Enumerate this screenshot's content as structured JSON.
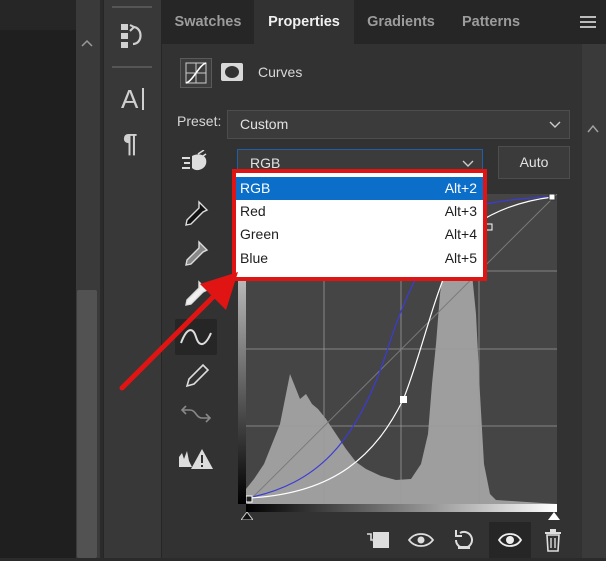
{
  "tabs": [
    {
      "label": "Swatches",
      "active": false
    },
    {
      "label": "Properties",
      "active": true
    },
    {
      "label": "Gradients",
      "active": false
    },
    {
      "label": "Patterns",
      "active": false
    }
  ],
  "header": {
    "title": "Curves",
    "icons": [
      "curves-adjustment-icon",
      "layer-mask-icon"
    ]
  },
  "preset": {
    "label": "Preset:",
    "value": "Custom"
  },
  "channel": {
    "value": "RGB",
    "auto_label": "Auto"
  },
  "channel_menu": {
    "items": [
      {
        "label": "RGB",
        "shortcut": "Alt+2",
        "active": true
      },
      {
        "label": "Red",
        "shortcut": "Alt+3",
        "active": false
      },
      {
        "label": "Green",
        "shortcut": "Alt+4",
        "active": false
      },
      {
        "label": "Blue",
        "shortcut": "Alt+5",
        "active": false
      }
    ]
  },
  "curve_tools": [
    "on-image-adjust-icon",
    "black-point-eyedropper-icon",
    "gray-point-eyedropper-icon",
    "white-point-eyedropper-icon",
    "point-curve-icon",
    "pencil-icon",
    "smooth-icon",
    "clipping-warning-icon"
  ],
  "side_tools": [
    "history-icon",
    "character-icon",
    "paragraph-icon"
  ],
  "bottom_actions": [
    "clip-to-layer-icon",
    "view-previous-icon",
    "reset-icon",
    "visibility-icon",
    "delete-icon"
  ],
  "colors": {
    "accent": "#0b6ec9",
    "highlight": "#e11414"
  }
}
